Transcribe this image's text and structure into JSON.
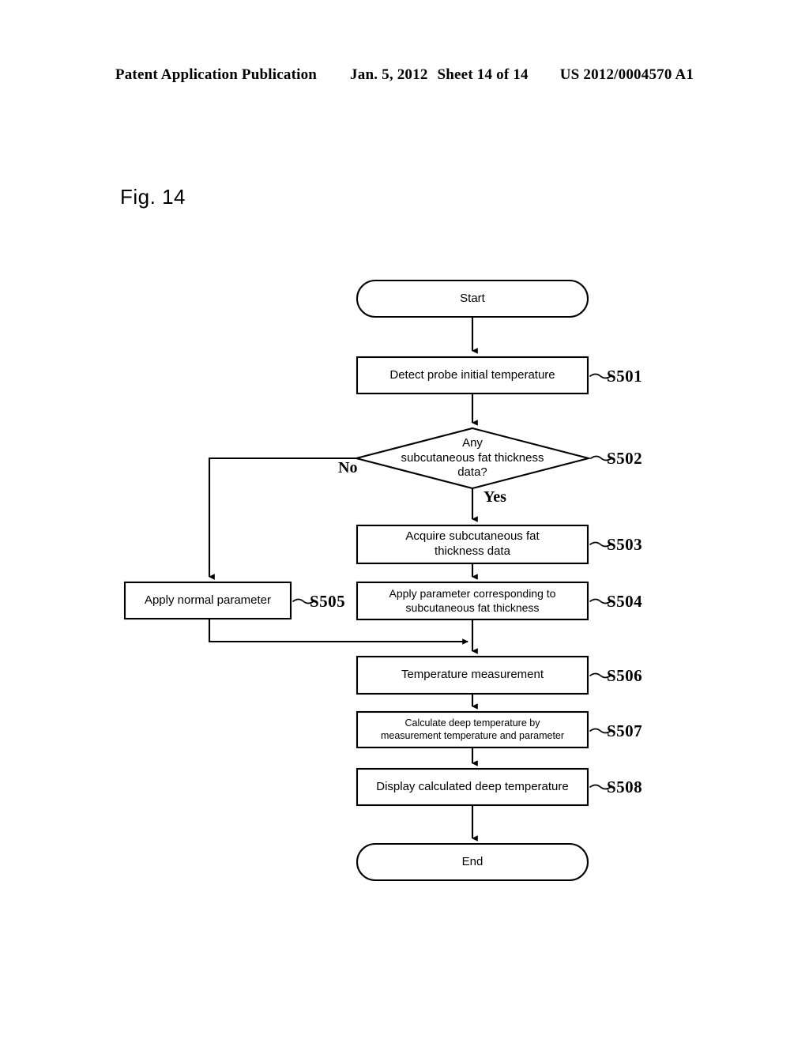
{
  "header": {
    "publication": "Patent Application Publication",
    "date": "Jan. 5, 2012",
    "sheet": "Sheet 14 of 14",
    "number": "US 2012/0004570 A1"
  },
  "figure": {
    "label": "Fig. 14"
  },
  "flowchart": {
    "nodes": {
      "start": {
        "text": "Start",
        "shape": "terminator"
      },
      "s501": {
        "text": "Detect probe initial temperature",
        "shape": "process",
        "ref": "S501"
      },
      "s502": {
        "text": "Any\nsubcutaneous fat thickness\ndata?",
        "shape": "decision",
        "ref": "S502"
      },
      "s503": {
        "text": "Acquire subcutaneous fat\nthickness data",
        "shape": "process",
        "ref": "S503"
      },
      "s504": {
        "text": "Apply parameter corresponding to\nsubcutaneous fat thickness",
        "shape": "process",
        "ref": "S504"
      },
      "s505": {
        "text": "Apply normal parameter",
        "shape": "process",
        "ref": "S505"
      },
      "s506": {
        "text": "Temperature measurement",
        "shape": "process",
        "ref": "S506"
      },
      "s507": {
        "text": "Calculate deep temperature by\nmeasurement temperature and parameter",
        "shape": "process",
        "ref": "S507"
      },
      "s508": {
        "text": "Display calculated deep temperature",
        "shape": "process",
        "ref": "S508"
      },
      "end": {
        "text": "End",
        "shape": "terminator"
      }
    },
    "branches": {
      "no": "No",
      "yes": "Yes"
    },
    "line_color": "#000000"
  }
}
